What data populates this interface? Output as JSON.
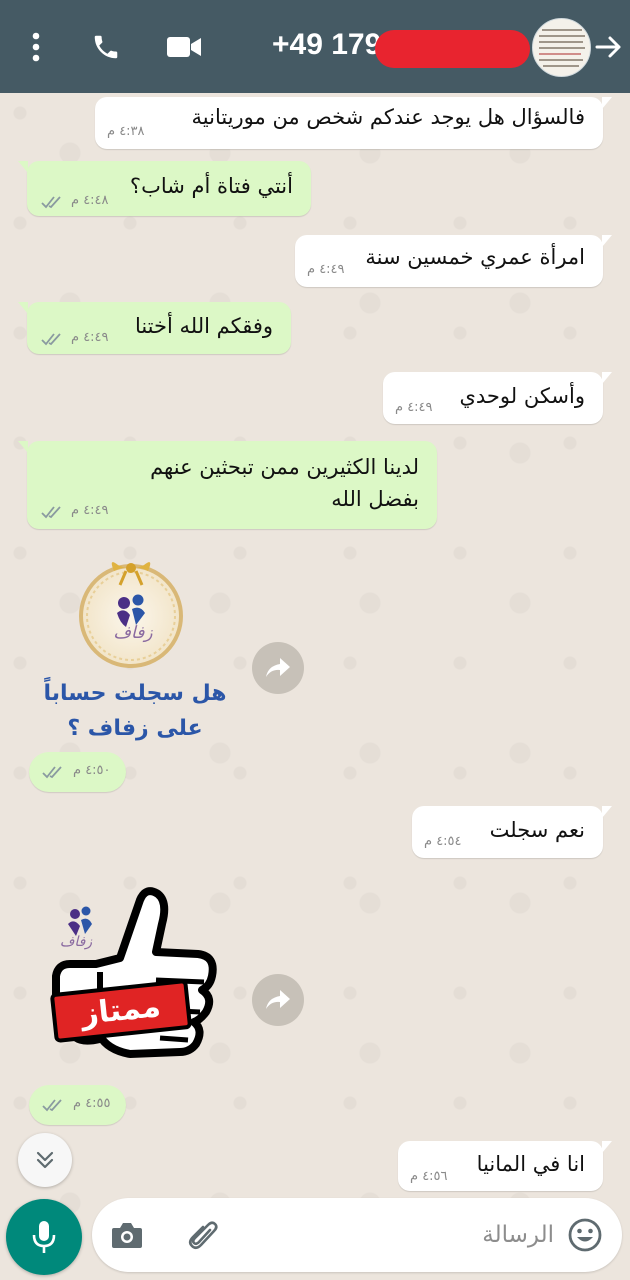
{
  "header": {
    "phone_number": "+49 179",
    "icons": [
      "menu-dots-icon",
      "phone-call-icon",
      "video-call-icon",
      "arrow-right-icon"
    ]
  },
  "messages": [
    {
      "id": "m1",
      "direction": "in",
      "text": "فالسؤال هل يوجد عندكم شخص من موريتانية",
      "time": "٤:٣٨ م"
    },
    {
      "id": "m2",
      "direction": "out",
      "text": "أنتي فتاة أم شاب؟",
      "time": "٤:٤٨ م"
    },
    {
      "id": "m3",
      "direction": "in",
      "text": "امرأة عمري خمسين سنة",
      "time": "٤:٤٩ م"
    },
    {
      "id": "m4",
      "direction": "out",
      "text": "وفقكم الله أختنا",
      "time": "٤:٤٩ م"
    },
    {
      "id": "m5",
      "direction": "in",
      "text": "وأسكن لوحدي",
      "time": "٤:٤٩ م"
    },
    {
      "id": "m6",
      "direction": "out",
      "text_line1": "لدينا الكثيرين ممن تبحثين عنهم",
      "text_line2": "بفضل الله",
      "time": "٤:٤٩ م"
    },
    {
      "id": "m7",
      "direction": "out",
      "type": "sticker",
      "caption_line1": "هل سجلت حساباً",
      "caption_line2": "على زفاف ؟",
      "logo_text": "زفاف",
      "time": "٤:٥٠ م"
    },
    {
      "id": "m8",
      "direction": "in",
      "text": "نعم سجلت",
      "time": "٤:٥٤ م"
    },
    {
      "id": "m9",
      "direction": "out",
      "type": "sticker",
      "sticker_text": "ممتاز",
      "logo_text": "زفاف",
      "time": "٤:٥٥ م"
    },
    {
      "id": "m10",
      "direction": "in",
      "text": "انا في المانيا",
      "time": "٤:٥٦ م"
    }
  ],
  "composer": {
    "placeholder": "الرسالة"
  },
  "colors": {
    "header": "#455a64",
    "incoming_bubble": "#ffffff",
    "outgoing_bubble": "#dcf8c6",
    "chat_background": "#ece5dd",
    "mic_button": "#00897b",
    "read_ticks": "#8a9aa0",
    "redaction": "#e8242f",
    "sticker_caption": "#2b56a8"
  }
}
